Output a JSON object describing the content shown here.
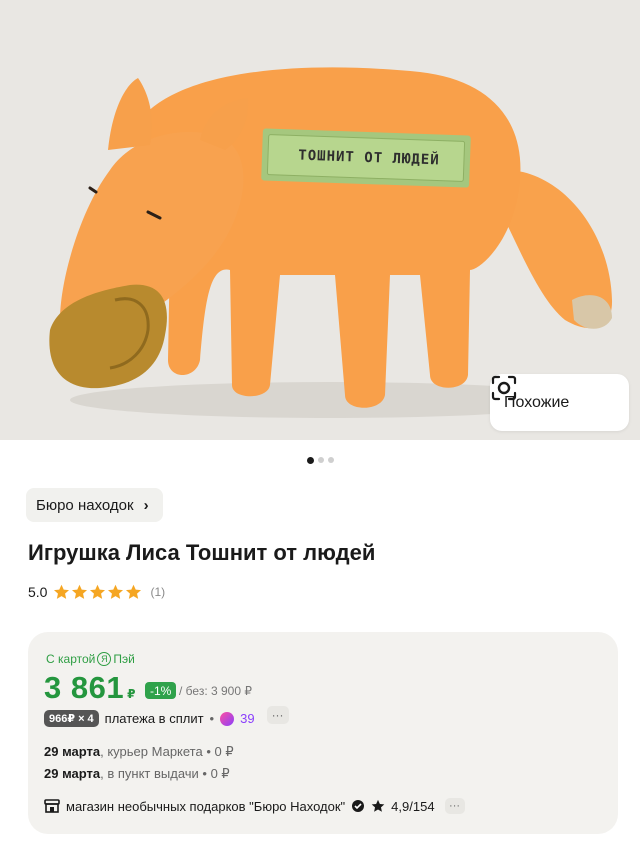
{
  "similar": {
    "label": "Похожие",
    "icon": "camera-search-icon"
  },
  "gallery": {
    "count": 3,
    "active": 1
  },
  "product": {
    "brand_chip": "Бюро находок",
    "title": "Игрушка Лиса Тошнит от людей",
    "label_text": "ТОШНИТ ОТ ЛЮДЕЙ",
    "rating": "5.0",
    "stars": 5,
    "reviews": "(1)"
  },
  "offer": {
    "pay_label_pre": "С картой",
    "pay_ya": "Я",
    "pay_label_post": "Пэй",
    "price": "3 861",
    "currency": "₽",
    "discount": "-1%",
    "old_price": "/ без: 3 900 ₽",
    "split_badge": "966₽ × 4",
    "split_text": "платежа в сплит",
    "plus_points": "39",
    "delivery": [
      {
        "date": "29 марта",
        "desc": ", курьер Маркета",
        "price": "0 ₽"
      },
      {
        "date": "29 марта",
        "desc": ", в пункт выдачи",
        "price": "0 ₽"
      }
    ],
    "shop_name": "магазин необычных подарков \"Бюро Находок\"",
    "shop_rating": "4,9/154"
  },
  "colors": {
    "price_green": "#24963e",
    "toy_orange": "#f9a04a",
    "star": "#f5a623"
  }
}
